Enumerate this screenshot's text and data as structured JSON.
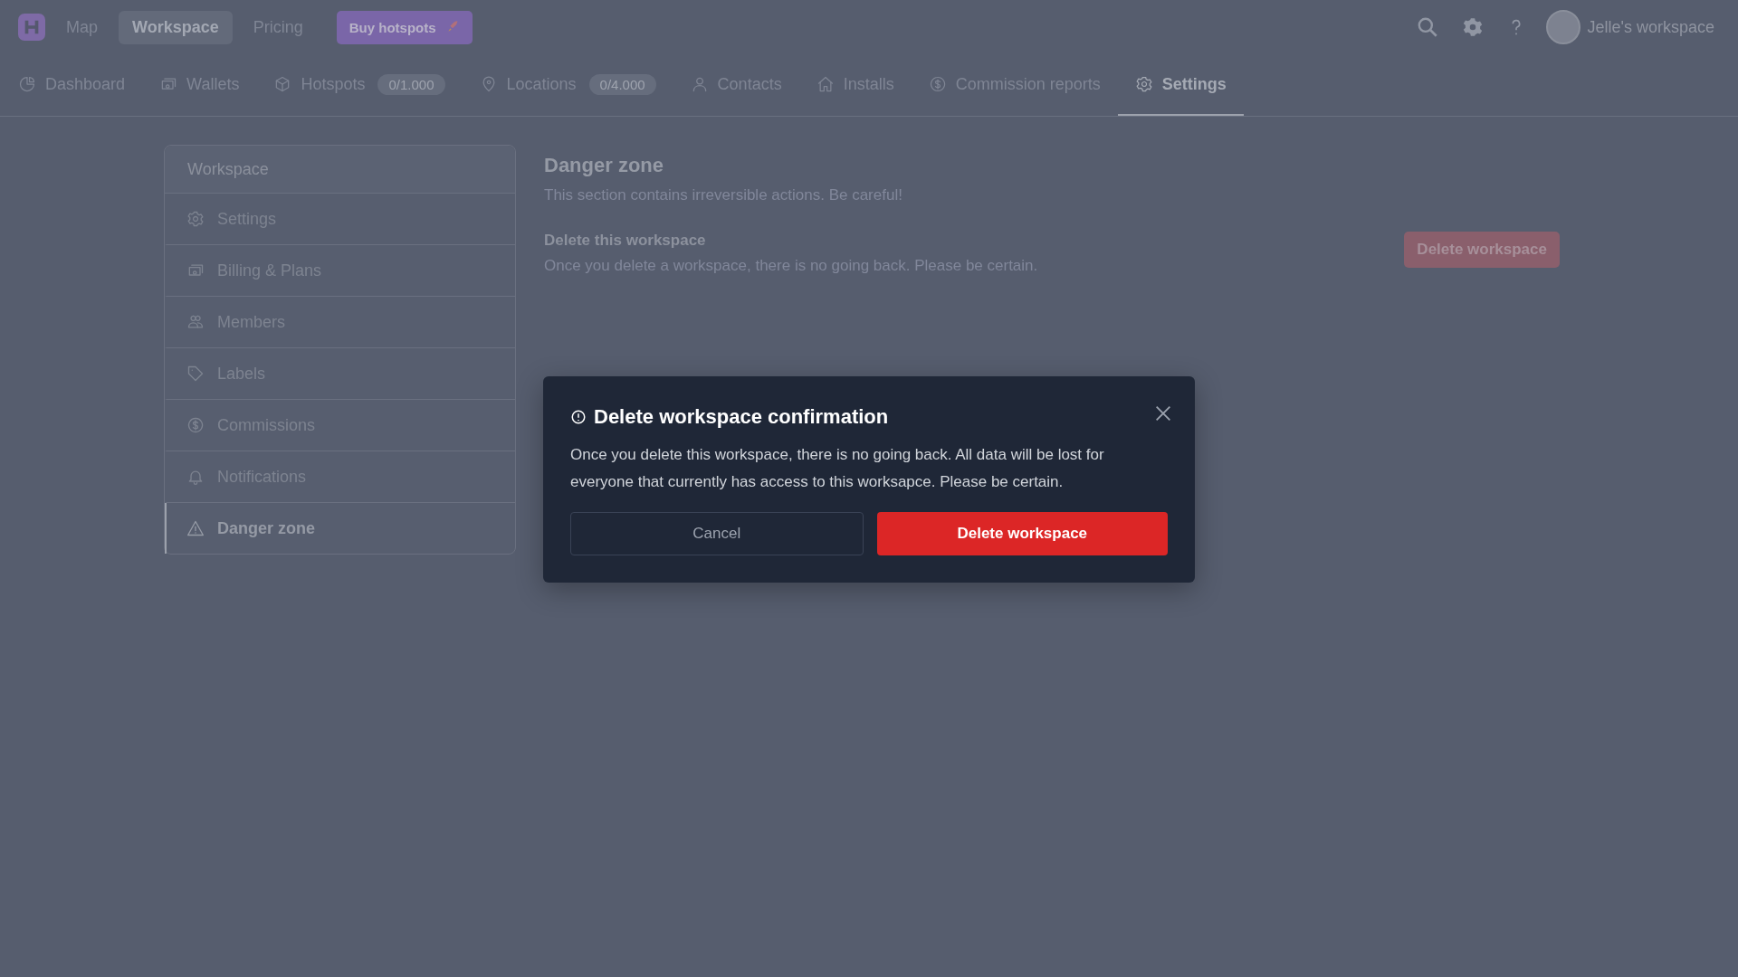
{
  "topbar": {
    "nav": [
      {
        "label": "Map",
        "selected": false
      },
      {
        "label": "Workspace",
        "selected": true
      },
      {
        "label": "Pricing",
        "selected": false
      }
    ],
    "buy_button": "Buy hotspots",
    "account": "Jelle's workspace"
  },
  "tabs": [
    {
      "label": "Dashboard",
      "selected": false
    },
    {
      "label": "Wallets",
      "selected": false
    },
    {
      "label": "Hotspots",
      "badge": "0/1.000",
      "selected": false
    },
    {
      "label": "Locations",
      "badge": "0/4.000",
      "selected": false
    },
    {
      "label": "Contacts",
      "selected": false
    },
    {
      "label": "Installs",
      "selected": false
    },
    {
      "label": "Commission reports",
      "selected": false
    },
    {
      "label": "Settings",
      "selected": true
    }
  ],
  "sidebar": {
    "title": "Workspace",
    "items": [
      {
        "label": "Settings",
        "selected": false
      },
      {
        "label": "Billing & Plans",
        "selected": false
      },
      {
        "label": "Members",
        "selected": false
      },
      {
        "label": "Labels",
        "selected": false
      },
      {
        "label": "Commissions",
        "selected": false
      },
      {
        "label": "Notifications",
        "selected": false
      },
      {
        "label": "Danger zone",
        "selected": true
      }
    ]
  },
  "section": {
    "title": "Danger zone",
    "subtitle": "This section contains irreversible actions. Be careful!",
    "item_title": "Delete this workspace",
    "item_text": "Once you delete a workspace, there is no going back. Please be certain.",
    "button": "Delete workspace"
  },
  "dialog": {
    "title": "Delete workspace confirmation",
    "text": "Once you delete this workspace, there is no going back. All data will be lost for everyone that currently has access to this worksapce. Please be certain.",
    "cancel": "Cancel",
    "confirm": "Delete workspace"
  }
}
